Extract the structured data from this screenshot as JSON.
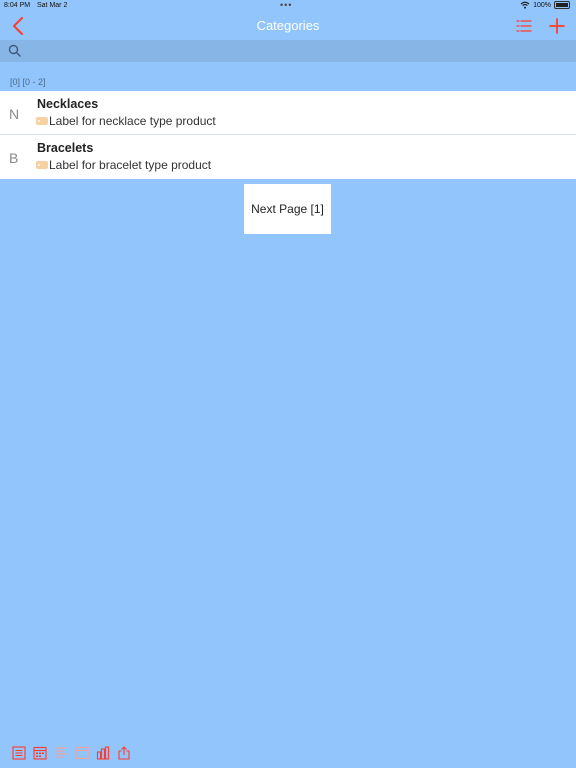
{
  "status": {
    "time": "8:04 PM",
    "date": "Sat Mar 2",
    "dots": "•••",
    "battery": "100%"
  },
  "nav": {
    "title": "Categories"
  },
  "search": {
    "placeholder": "",
    "value": ""
  },
  "range_label": "[0] [0 - 2]",
  "categories": [
    {
      "index": "N",
      "name": "Necklaces",
      "description": "Label for necklace type product"
    },
    {
      "index": "B",
      "name": "Bracelets",
      "description": "Label for bracelet type product"
    }
  ],
  "next_page_label": "Next Page [1]",
  "colors": {
    "accent": "#ff3b30",
    "background": "#92c5fb",
    "search_bg": "#86b5e6",
    "row_bg": "#ffffff"
  },
  "icons": {
    "nav": [
      "chevron-left-icon",
      "list-icon",
      "plus-icon"
    ],
    "toolbar": [
      "document-icon",
      "calendar-icon",
      "text-lines-icon",
      "window-icon",
      "bar-chart-icon",
      "share-icon"
    ]
  }
}
